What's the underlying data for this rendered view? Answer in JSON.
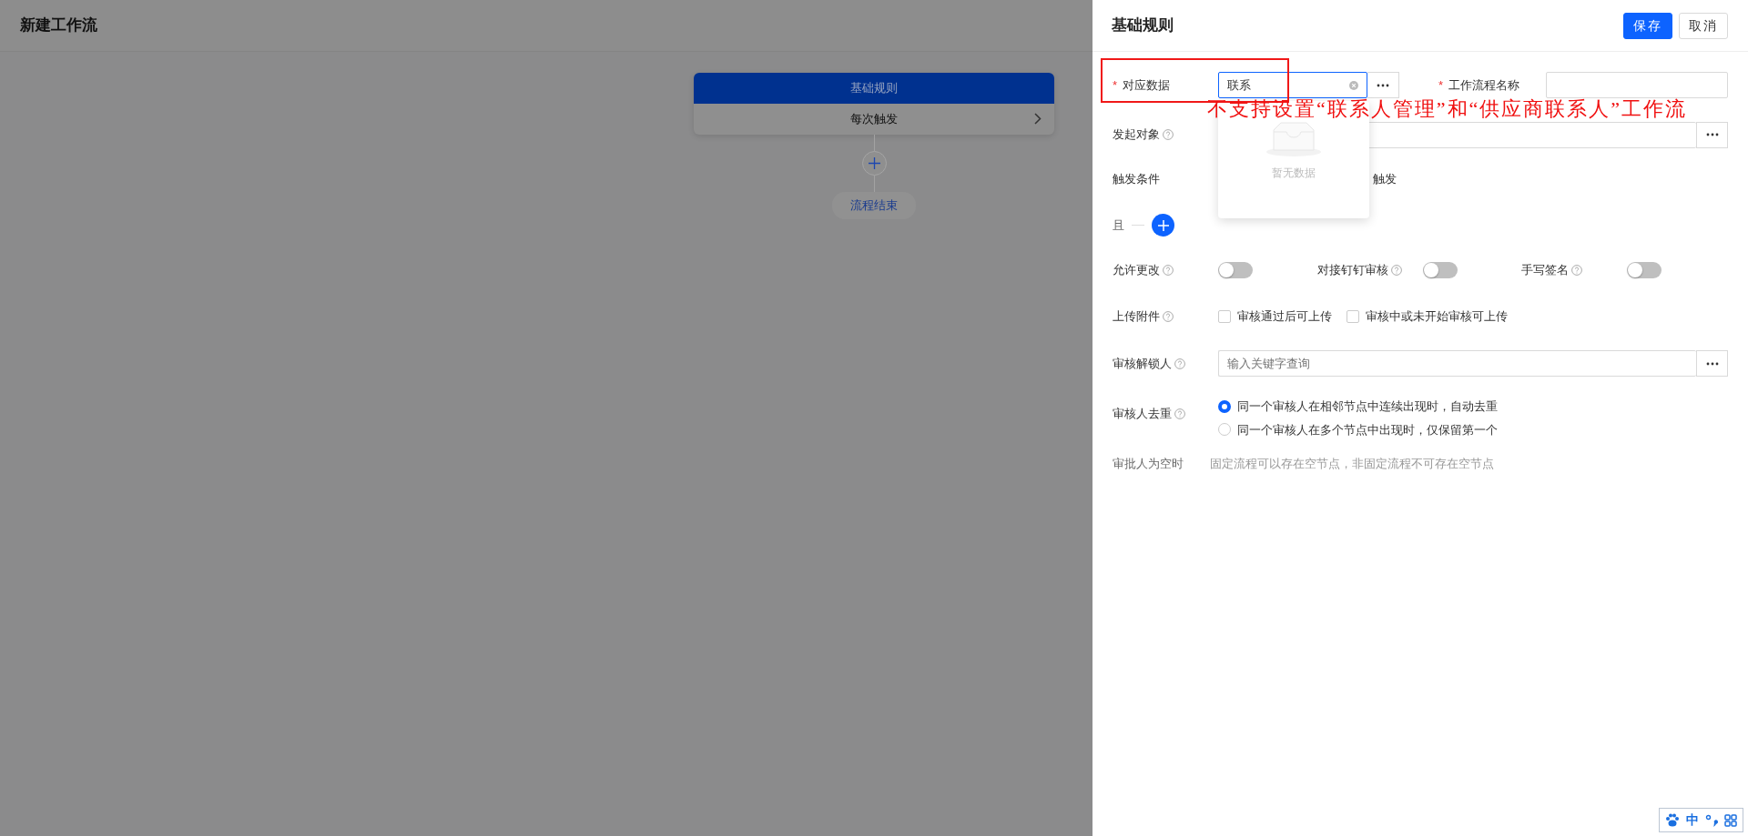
{
  "page": {
    "title": "新建工作流"
  },
  "rule_node": {
    "title": "基础规则",
    "trigger": "每次触发"
  },
  "end_node": {
    "label": "流程结束"
  },
  "drawer": {
    "title": "基础规则",
    "buttons": [
      {
        "label": "保存",
        "kind": "primary"
      },
      {
        "label": "取消",
        "kind": "default"
      }
    ],
    "data_field": {
      "required_mark": "*",
      "label": "对应数据",
      "value": "联系"
    },
    "name_field": {
      "required_mark": "*",
      "label": "工作流程名称"
    },
    "initiator": {
      "label": "发起对象",
      "help": true
    },
    "trigger": {
      "label": "触发条件",
      "value": "触发"
    },
    "conditions": {
      "connector": "且"
    },
    "switches": [
      {
        "label": "允许更改",
        "help": true,
        "on": false
      },
      {
        "label": "对接钉钉审核",
        "help": true,
        "on": false
      },
      {
        "label": "手写签名",
        "help": true,
        "on": false
      }
    ],
    "attachments": {
      "label": "上传附件",
      "help": true,
      "options": [
        {
          "label": "审核通过后可上传",
          "checked": false
        },
        {
          "label": "审核中或未开始审核可上传",
          "checked": false
        }
      ]
    },
    "unlocker": {
      "label": "审核解锁人",
      "help": true,
      "placeholder": "输入关键字查询"
    },
    "dedupe": {
      "label": "审核人去重",
      "help": true,
      "options": [
        {
          "label": "同一个审核人在相邻节点中连续出现时，自动去重",
          "selected": true
        },
        {
          "label": "同一个审核人在多个节点中出现时，仅保留第一个",
          "selected": false
        }
      ]
    },
    "empty_approver": {
      "label": "审批人为空时",
      "text": "固定流程可以存在空节点，非固定流程不可存在空节点"
    }
  },
  "dropdown": {
    "empty_text": "暂无数据"
  },
  "annotation": {
    "text": "不支持设置“联系人管理”和“供应商联系人”工作流"
  },
  "ime": {
    "mode": "中"
  }
}
